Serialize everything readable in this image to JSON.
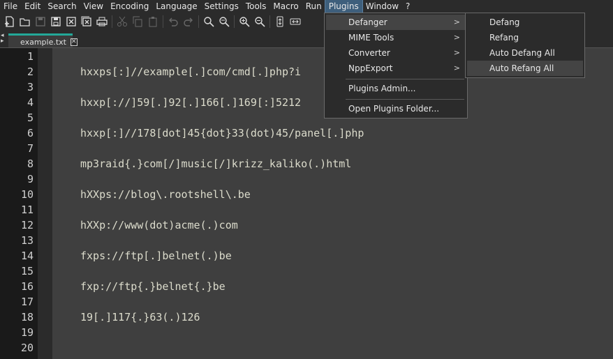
{
  "menubar": {
    "items": [
      "File",
      "Edit",
      "Search",
      "View",
      "Encoding",
      "Language",
      "Settings",
      "Tools",
      "Macro",
      "Run",
      "Plugins",
      "Window",
      "?"
    ]
  },
  "toolbar": {
    "icons": [
      "new-file-icon",
      "open-file-icon",
      "save-icon",
      "save-all-icon",
      "close-icon",
      "close-all-icon",
      "print-icon",
      "cut-icon",
      "copy-icon",
      "paste-icon",
      "undo-icon",
      "redo-icon",
      "find-icon",
      "replace-icon",
      "zoom-in-icon",
      "zoom-out-icon",
      "sync-vertical-icon",
      "sync-horizontal-icon"
    ]
  },
  "tab": {
    "label": "example.txt",
    "close_glyph": "✕",
    "scroll_glyph": "◂\n▸"
  },
  "editor": {
    "line_numbers": [
      "1",
      "2",
      "3",
      "4",
      "5",
      "6",
      "7",
      "8",
      "9",
      "10",
      "11",
      "12",
      "13",
      "14",
      "15",
      "16",
      "17",
      "18",
      "19",
      "20"
    ],
    "lines": [
      "hxxps[:]//example[.]com/cmd[.]php?i",
      "hxxp[://]59[.]92[.]166[.]169[:]5212",
      "hxxp[:]//178[dot]45{dot}33(dot)45/panel[.]php",
      "mp3raid{.}com[/]music[/]krizz_kaliko(.)html",
      "hXXps://blog\\.rootshell\\.be",
      "hXXp://www(dot)acme(.)com",
      "fxps://ftp[.]belnet(.)be",
      "fxp://ftp{.}belnet{.}be",
      "19[.]117{.}63(.)126"
    ]
  },
  "plugins_menu": {
    "items": [
      "Defanger",
      "MIME Tools",
      "Converter",
      "NppExport",
      "Plugins Admin...",
      "Open Plugins Folder..."
    ],
    "submenu_arrow": ">"
  },
  "defanger_menu": {
    "items": [
      "Defang",
      "Refang",
      "Auto Defang All",
      "Auto Refang All"
    ]
  },
  "colors": {
    "menu_bg": "#2b2b2b",
    "editor_bg": "#3f3f3f",
    "gutter_bg": "#1a1a1a",
    "tab_accent": "#23a899",
    "menu_active": "#3e5f7c"
  }
}
